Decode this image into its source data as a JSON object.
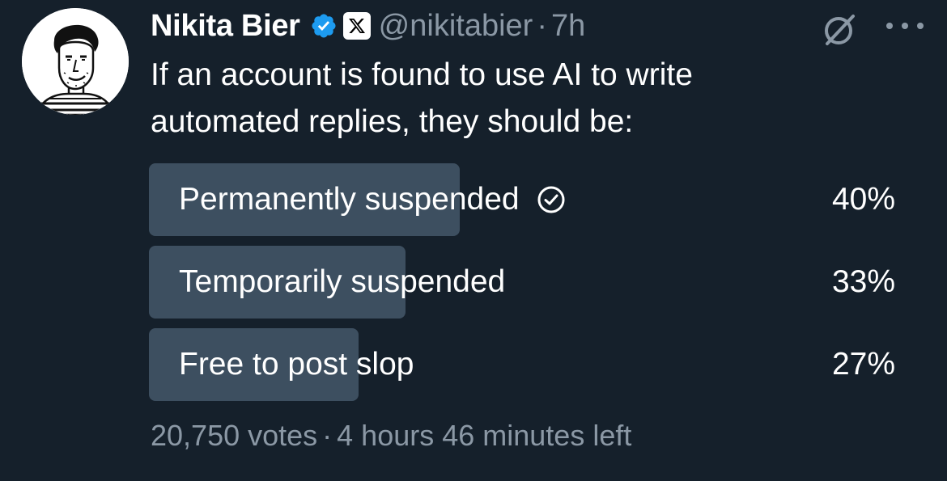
{
  "author": {
    "name": "Nikita Bier",
    "handle": "@nikitabier",
    "time": "7h",
    "separator": "·",
    "verified_color": "#1d9bf0",
    "badges": [
      "verified-badge-icon",
      "x-affiliate-badge-icon"
    ]
  },
  "tweet": {
    "text_lines": [
      "If an account is found to use AI to write",
      "automated replies, they should be:"
    ]
  },
  "actions": {
    "icons": [
      "grok-icon",
      "more-options-icon"
    ]
  },
  "poll": {
    "options": [
      {
        "label": "Permanently suspended",
        "percent": "40%",
        "value": 40,
        "selected": true
      },
      {
        "label": "Temporarily suspended",
        "percent": "33%",
        "value": 33,
        "selected": false
      },
      {
        "label": "Free to post slop",
        "percent": "27%",
        "value": 27,
        "selected": false
      }
    ],
    "votes": "20,750 votes",
    "separator": "·",
    "time_left": "4 hours 46 minutes left",
    "bar_color": "#3d4f60"
  },
  "colors": {
    "background": "#15202b",
    "text_primary": "#ffffff",
    "text_secondary": "#8b98a5"
  }
}
